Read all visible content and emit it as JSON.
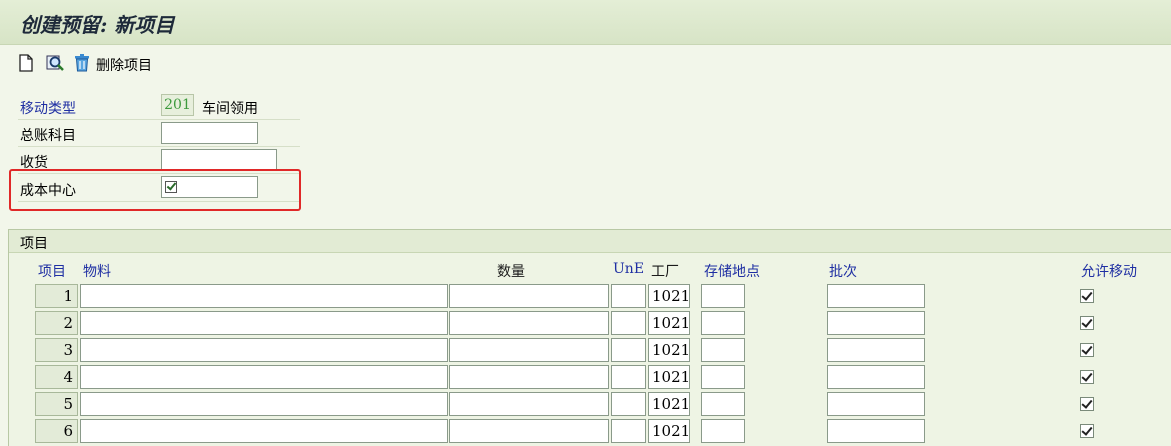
{
  "title": "创建预留: 新项目",
  "toolbar": {
    "new_icon": "document-icon",
    "find_icon": "magnifier-icon",
    "delete_icon": "trash-icon",
    "delete_label": "删除项目"
  },
  "header": {
    "movement_type_label": "移动类型",
    "movement_type_value": "201",
    "movement_type_text": "车间领用",
    "gl_account_label": "总账科目",
    "gl_account_value": "",
    "goods_recipient_label": "收货",
    "goods_recipient_value": "",
    "cost_center_label": "成本中心",
    "cost_center_value": ""
  },
  "items_section": {
    "title": "项目",
    "columns": {
      "item": "项目",
      "material": "物料",
      "quantity": "数量",
      "unit": "UnE",
      "plant": "工厂",
      "storage_location": "存储地点",
      "batch": "批次",
      "movement_allowed": "允许移动"
    },
    "rows": [
      {
        "item": "1",
        "material": "",
        "quantity": "",
        "unit": "",
        "plant": "1021",
        "storage_location": "",
        "batch": "",
        "movement_allowed": true
      },
      {
        "item": "2",
        "material": "",
        "quantity": "",
        "unit": "",
        "plant": "1021",
        "storage_location": "",
        "batch": "",
        "movement_allowed": true
      },
      {
        "item": "3",
        "material": "",
        "quantity": "",
        "unit": "",
        "plant": "1021",
        "storage_location": "",
        "batch": "",
        "movement_allowed": true
      },
      {
        "item": "4",
        "material": "",
        "quantity": "",
        "unit": "",
        "plant": "1021",
        "storage_location": "",
        "batch": "",
        "movement_allowed": true
      },
      {
        "item": "5",
        "material": "",
        "quantity": "",
        "unit": "",
        "plant": "1021",
        "storage_location": "",
        "batch": "",
        "movement_allowed": true
      },
      {
        "item": "6",
        "material": "",
        "quantity": "",
        "unit": "",
        "plant": "1021",
        "storage_location": "",
        "batch": "",
        "movement_allowed": true
      }
    ]
  },
  "colors": {
    "label_blue": "#1f2fa3",
    "highlight_red": "#e02828",
    "background": "#f2f6ea"
  }
}
